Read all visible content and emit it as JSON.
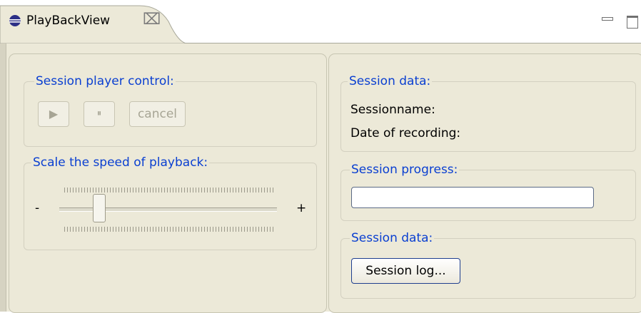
{
  "tab": {
    "title": "PlayBackView",
    "close_glyph": "⌧"
  },
  "player_control": {
    "legend": "Session player control:",
    "play_glyph": "▶",
    "pause_glyph": "⏸",
    "cancel_label": "cancel"
  },
  "speed": {
    "legend": "Scale the speed of playback:",
    "minus_label": "-",
    "plus_label": "+",
    "value_fraction": 0.19
  },
  "session_data": {
    "legend": "Session data:",
    "name_label": "Sessionname:",
    "date_label": "Date of recording:"
  },
  "session_progress": {
    "legend": "Session progress:",
    "value": 0
  },
  "session_log": {
    "legend": "Session data:",
    "button_label": "Session log..."
  },
  "colors": {
    "legend": "#0a3fd1",
    "panel_bg": "#ece9d8"
  }
}
